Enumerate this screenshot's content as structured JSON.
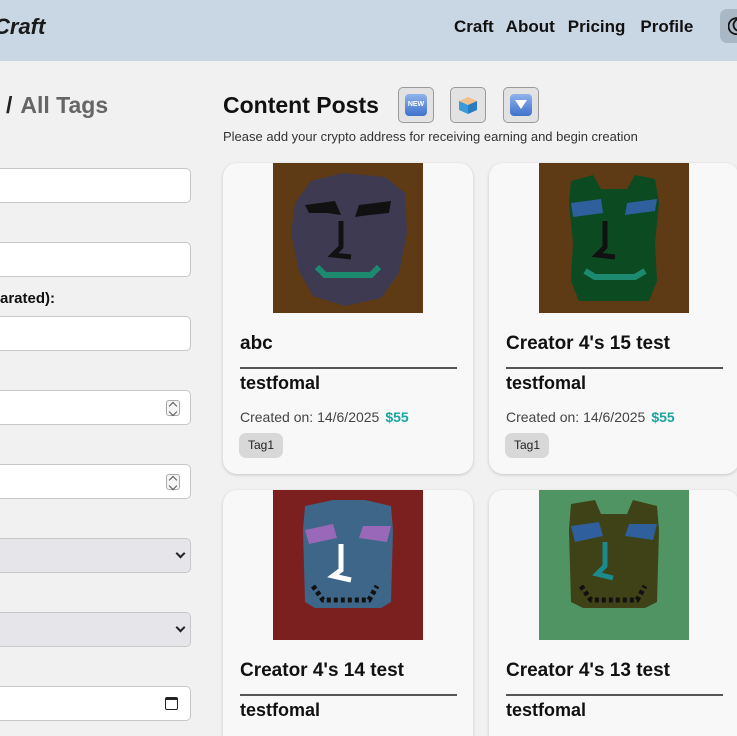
{
  "header": {
    "logo": "Craft",
    "nav": [
      "Craft",
      "About",
      "Pricing",
      "Profile"
    ]
  },
  "sidebar": {
    "title_sep": "/",
    "title": "All Tags",
    "tags_label": "arated):"
  },
  "main": {
    "title": "Content Posts",
    "new_icon_text": "NEW",
    "subtitle": "Please add your crypto address for receiving earning and begin creation"
  },
  "posts": [
    {
      "title": "abc",
      "author": "testfomal",
      "created_label": "Created on:",
      "date": "14/6/2025",
      "price": "$55",
      "tag": "Tag1",
      "bg": "#5e3b14",
      "face": "#3d3a52"
    },
    {
      "title": "Creator 4's 15 test",
      "author": "testfomal",
      "created_label": "Created on:",
      "date": "14/6/2025",
      "price": "$55",
      "tag": "Tag1",
      "bg": "#5e3b14",
      "face": "#0c4a22"
    },
    {
      "title": "Creator 4's 14 test",
      "author": "testfomal",
      "bg": "#7c1f1f",
      "face": "#3e6688"
    },
    {
      "title": "Creator 4's 13 test",
      "author": "testfomal",
      "bg": "#4f9462",
      "face": "#3e4216"
    }
  ],
  "colors": {
    "header": "#c9d6e3",
    "price": "#19a5a0",
    "background": "#f1f1f1"
  }
}
